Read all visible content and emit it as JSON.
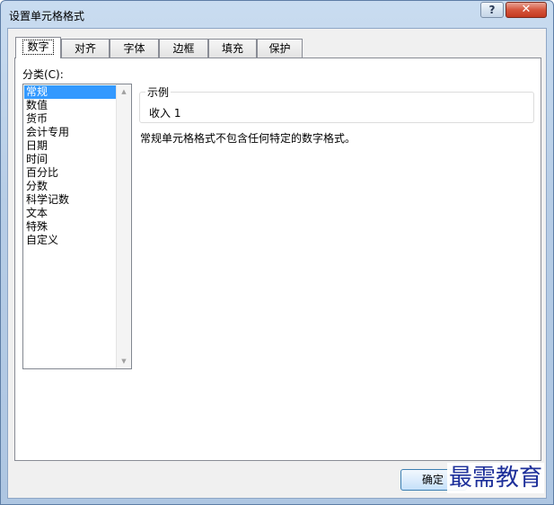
{
  "window": {
    "title": "设置单元格格式",
    "help_label": "?",
    "close_label": "✕"
  },
  "tabs": [
    {
      "label": "数字",
      "active": true
    },
    {
      "label": "对齐",
      "active": false
    },
    {
      "label": "字体",
      "active": false
    },
    {
      "label": "边框",
      "active": false
    },
    {
      "label": "填充",
      "active": false
    },
    {
      "label": "保护",
      "active": false
    }
  ],
  "category": {
    "label": "分类(C):",
    "items": [
      "常规",
      "数值",
      "货币",
      "会计专用",
      "日期",
      "时间",
      "百分比",
      "分数",
      "科学记数",
      "文本",
      "特殊",
      "自定义"
    ],
    "selected": "常规"
  },
  "sample": {
    "legend": "示例",
    "value": "收入 1"
  },
  "description": "常规单元格格式不包含任何特定的数字格式。",
  "buttons": {
    "ok": "确定"
  },
  "watermark": "最需教育",
  "icons": {
    "scroll_up": "scroll-up-arrow-icon",
    "scroll_down": "scroll-down-arrow-icon"
  },
  "colors": {
    "selection": "#3399ff",
    "close_button": "#c43a20",
    "watermark": "#1d2f9a"
  }
}
